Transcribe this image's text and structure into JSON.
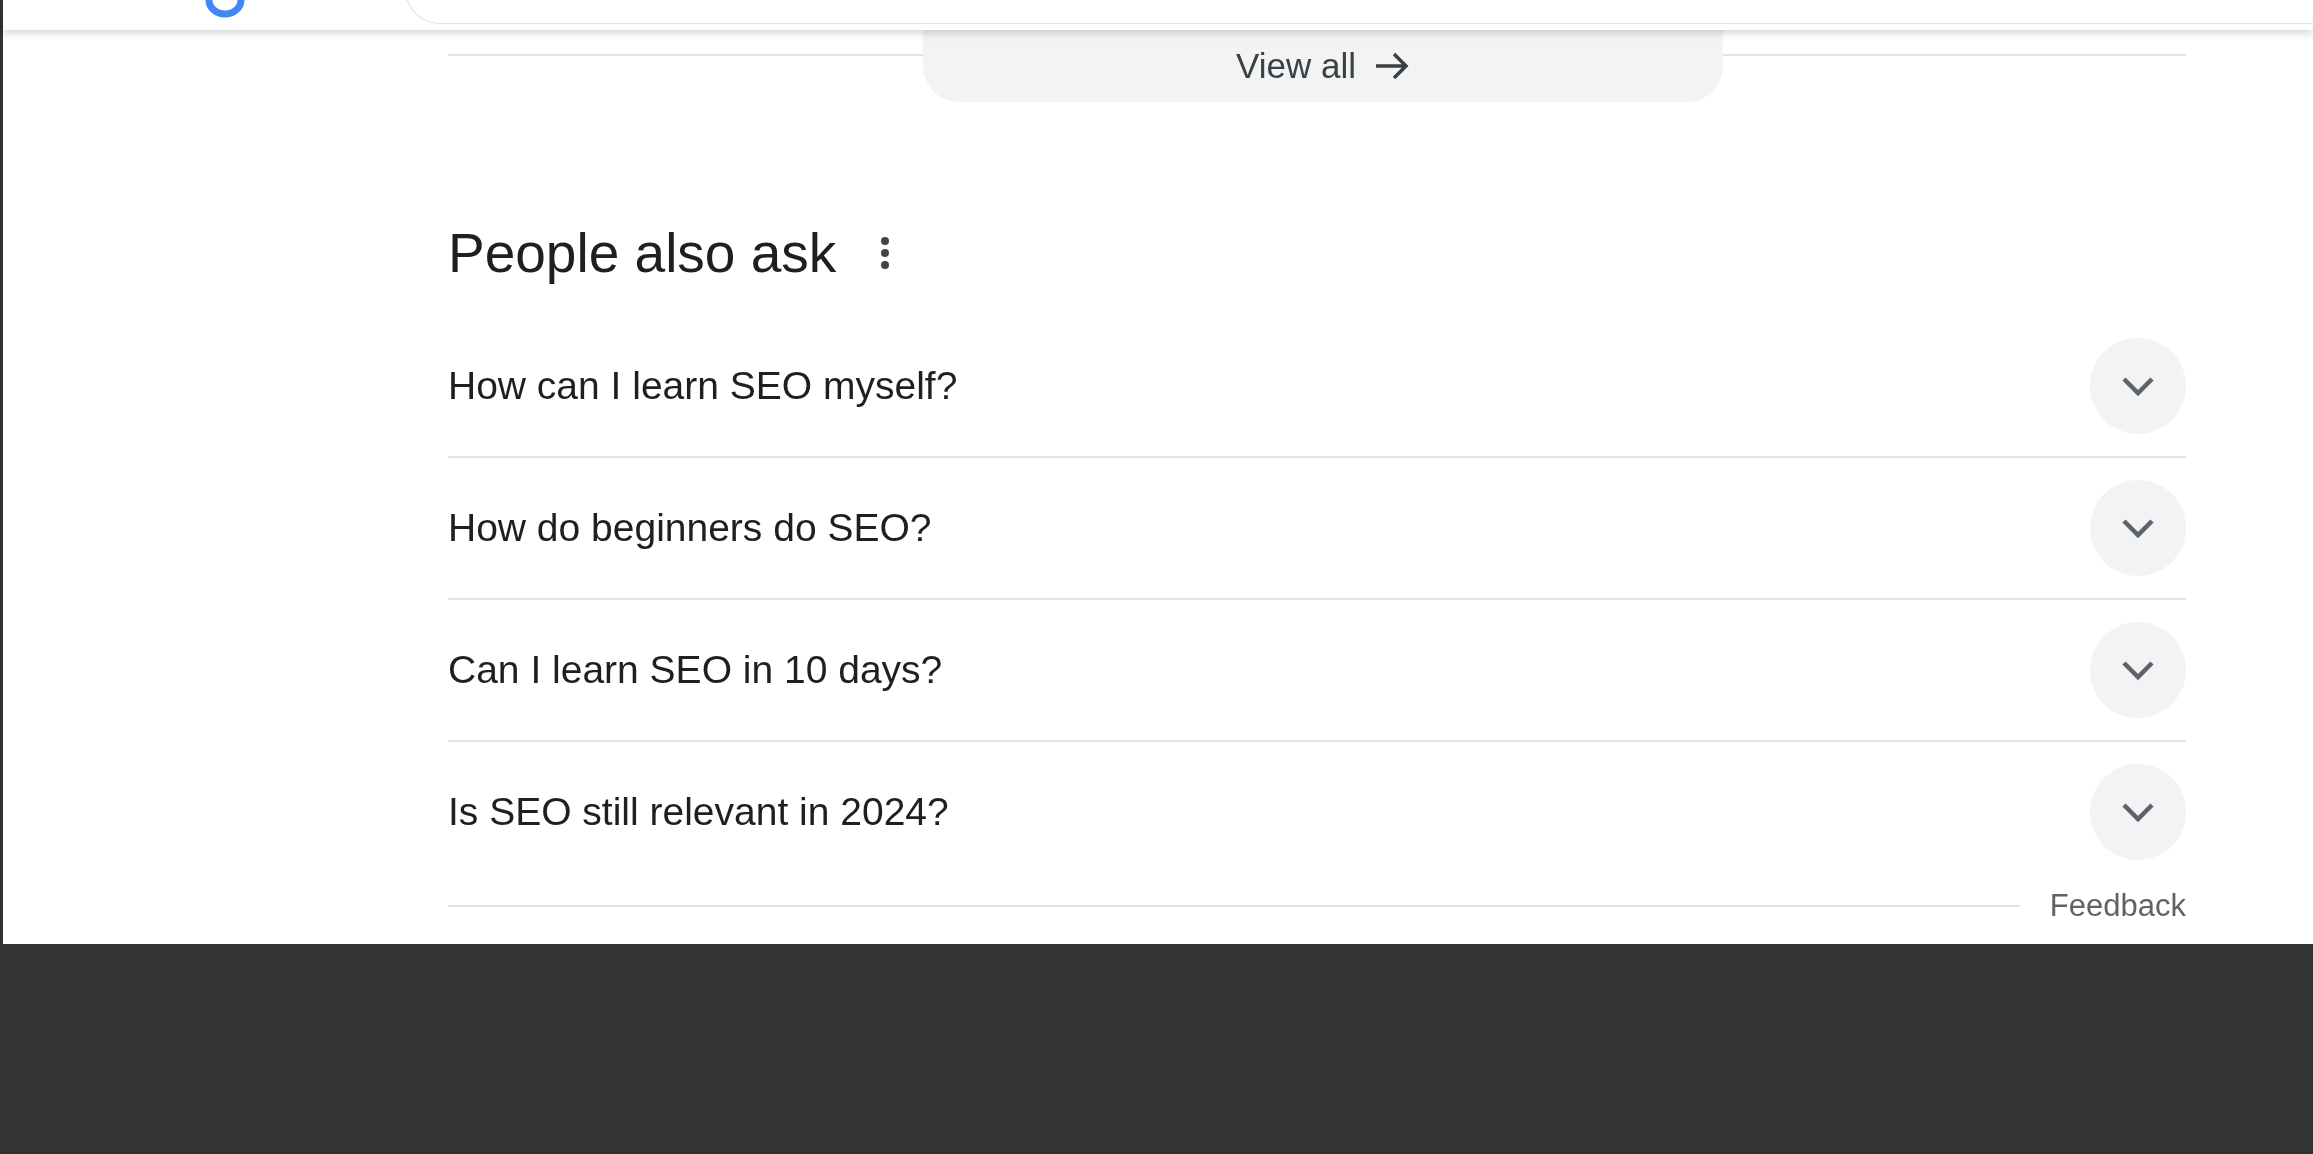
{
  "view_all": {
    "label": "View all"
  },
  "people_also_ask": {
    "title": "People also ask",
    "questions": [
      {
        "text": "How can I learn SEO myself?",
        "expanded": false
      },
      {
        "text": "How do beginners do SEO?",
        "expanded": false
      },
      {
        "text": "Can I learn SEO in 10 days?",
        "expanded": false
      },
      {
        "text": "Is SEO still relevant in 2024?",
        "expanded": false
      }
    ]
  },
  "feedback": {
    "label": "Feedback"
  }
}
